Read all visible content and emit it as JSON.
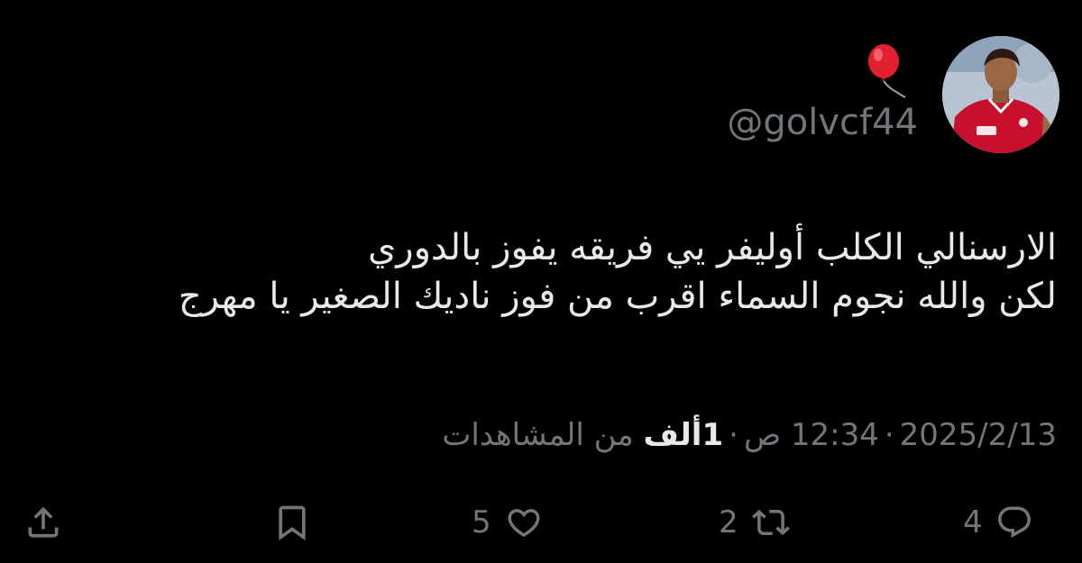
{
  "author": {
    "handle": "@golvcf44",
    "avatar_icon": "avatar-player-photo",
    "badge_icon": "red-balloon-emoji"
  },
  "tweet": {
    "lines": [
      "الارسنالي الكلب أوليفر يي فريقه يفوز بالدوري",
      "لكن والله نجوم السماء اقرب من فوز ناديك الصغير يا مهرج"
    ]
  },
  "meta": {
    "date": "2025/2/13",
    "time": "12:34 ص",
    "separator": "·",
    "views_count": "1ألف",
    "views_label": "من المشاهدات"
  },
  "actions": {
    "reply_count": "4",
    "retweet_count": "2",
    "like_count": "5"
  },
  "colors": {
    "background": "#000000",
    "primary_text": "#e7e9ea",
    "secondary_text": "#71767b"
  }
}
